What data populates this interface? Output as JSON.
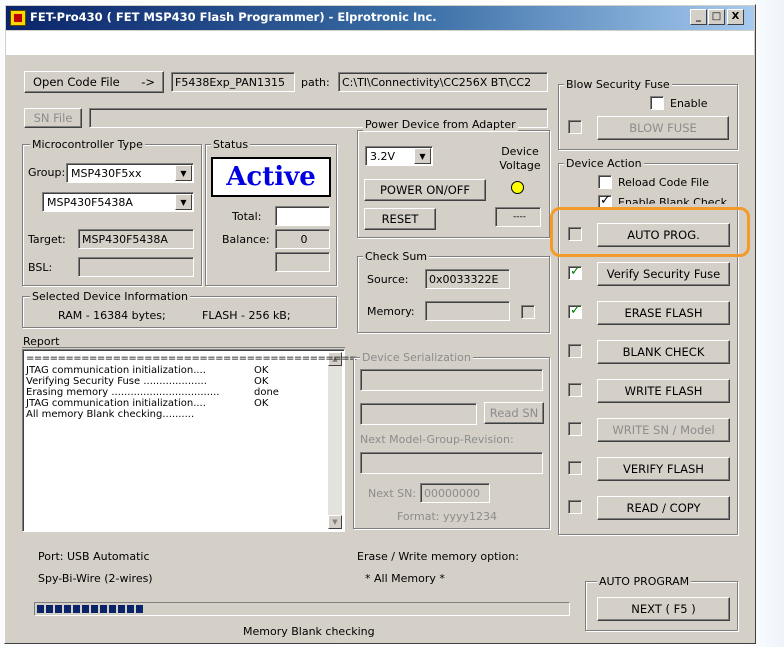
{
  "window": {
    "title": "FET-Pro430  ( FET MSP430 Flash Programmer)  -  Elprotronic Inc.",
    "controls": [
      "_",
      "□",
      "X"
    ]
  },
  "top_row": {
    "open_code_button": "Open Code File",
    "arrow": "->",
    "code_file_value": "F5438Exp_PAN1315",
    "path_label": "path:",
    "path_value": "C:\\TI\\Connectivity\\CC256X BT\\CC2",
    "sn_file_button": "SN File",
    "sn_file_value": ""
  },
  "microcontroller": {
    "group_title": "Microcontroller Type",
    "group_label": "Group:",
    "group_value": "MSP430F5xx",
    "device_value": "MSP430F5438A",
    "target_label": "Target:",
    "target_value": "MSP430F5438A",
    "bsl_label": "BSL:",
    "bsl_value": ""
  },
  "status": {
    "title": "Status",
    "state": "Active",
    "total_label": "Total:",
    "total_value": "",
    "balance_label": "Balance:",
    "balance_value": "0",
    "extra_value": ""
  },
  "power": {
    "title": "Power Device from Adapter",
    "voltage_value": "3.2V",
    "device_voltage_label": "Device Voltage",
    "power_button": "POWER ON/OFF",
    "reset_button": "RESET",
    "voltage_readout": "----",
    "led_color": "#ffff00"
  },
  "checksum": {
    "title": "Check Sum",
    "source_label": "Source:",
    "source_value": "0x0033322E",
    "memory_label": "Memory:",
    "memory_value": ""
  },
  "device_info": {
    "title": "Selected Device Information",
    "ram": "RAM - 16384 bytes;",
    "flash": "FLASH - 256 kB;"
  },
  "report": {
    "title": "Report",
    "lines": [
      [
        "==========================================",
        ""
      ],
      [
        "JTAG communication initialization....",
        "OK"
      ],
      [
        "Verifying Security Fuse ....................",
        "OK"
      ],
      [
        "Erasing memory ..................................",
        "done"
      ],
      [
        "JTAG communication initialization....",
        "OK"
      ],
      [
        "All memory Blank checking..........",
        ""
      ]
    ]
  },
  "serialization": {
    "title": "Device Serialization",
    "read_sn_button": "Read SN",
    "next_model_label": "Next Model-Group-Revision:",
    "next_sn_label": "Next SN:",
    "next_sn_value": "00000000",
    "format_label": "Format: yyyy1234"
  },
  "security_fuse": {
    "title": "Blow Security Fuse",
    "enable_label": "Enable",
    "blow_button": "BLOW FUSE"
  },
  "device_action": {
    "title": "Device Action",
    "reload_label": "Reload Code File",
    "enable_blank_label": "Enable Blank Check",
    "actions": [
      {
        "label": "AUTO PROG.",
        "checked": false,
        "enabled": true
      },
      {
        "label": "Verify Security Fuse",
        "checked": true,
        "enabled": true
      },
      {
        "label": "ERASE FLASH",
        "checked": true,
        "enabled": true
      },
      {
        "label": "BLANK CHECK",
        "checked": false,
        "enabled": true
      },
      {
        "label": "WRITE FLASH",
        "checked": false,
        "enabled": true
      },
      {
        "label": "WRITE SN / Model",
        "checked": false,
        "enabled": false
      },
      {
        "label": "VERIFY FLASH",
        "checked": false,
        "enabled": true
      },
      {
        "label": "READ / COPY",
        "checked": false,
        "enabled": true
      }
    ],
    "highlight_color": "#f39a2b"
  },
  "bottom": {
    "port": "Port: USB Automatic",
    "interface": "Spy-Bi-Wire (2-wires)",
    "erase_option_label": "Erase / Write memory option:",
    "erase_option_value": "* All Memory *",
    "auto_program_title": "AUTO PROGRAM",
    "next_button": "NEXT  ( F5 )",
    "progress_fraction": 0.2,
    "progress_text": "Memory Blank checking"
  }
}
